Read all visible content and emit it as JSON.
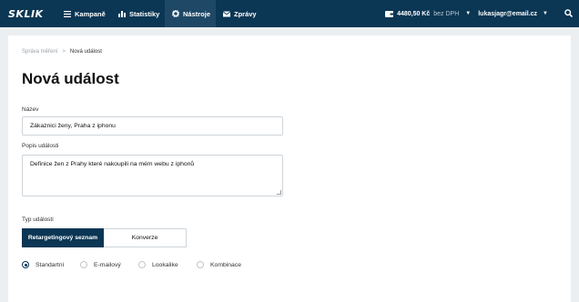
{
  "nav": {
    "logo": "SKLIK",
    "items": [
      {
        "label": "Kampaně",
        "icon": "menu-icon",
        "active": false
      },
      {
        "label": "Statistiky",
        "icon": "bar-chart-icon",
        "active": false
      },
      {
        "label": "Nástroje",
        "icon": "gear-icon",
        "active": true
      },
      {
        "label": "Zprávy",
        "icon": "mail-icon",
        "active": false
      }
    ],
    "wallet": {
      "amount": "4480,50 Kč",
      "note": "bez DPH",
      "icon": "wallet-icon"
    },
    "user": "lukasjagr@email.cz",
    "search_icon": "search-icon"
  },
  "breadcrumb": {
    "parent": "Správa měření",
    "separator": ">",
    "current": "Nová událost"
  },
  "page_title": "Nová událost",
  "form": {
    "name_label": "Název",
    "name_value": "Zákaznici ženy, Praha z iphonu",
    "description_label": "Popis události",
    "description_value": "Definice žen z Prahy které nakoupili na mém webu z iphonů",
    "type_label": "Typ události",
    "type_options": [
      {
        "label": "Retargetingový seznam",
        "active": true
      },
      {
        "label": "Konverze",
        "active": false
      }
    ],
    "radio_options": [
      {
        "label": "Standartní",
        "checked": true
      },
      {
        "label": "E-mailový",
        "checked": false
      },
      {
        "label": "Lookalike",
        "checked": false
      },
      {
        "label": "Kombinace",
        "checked": false
      }
    ]
  }
}
